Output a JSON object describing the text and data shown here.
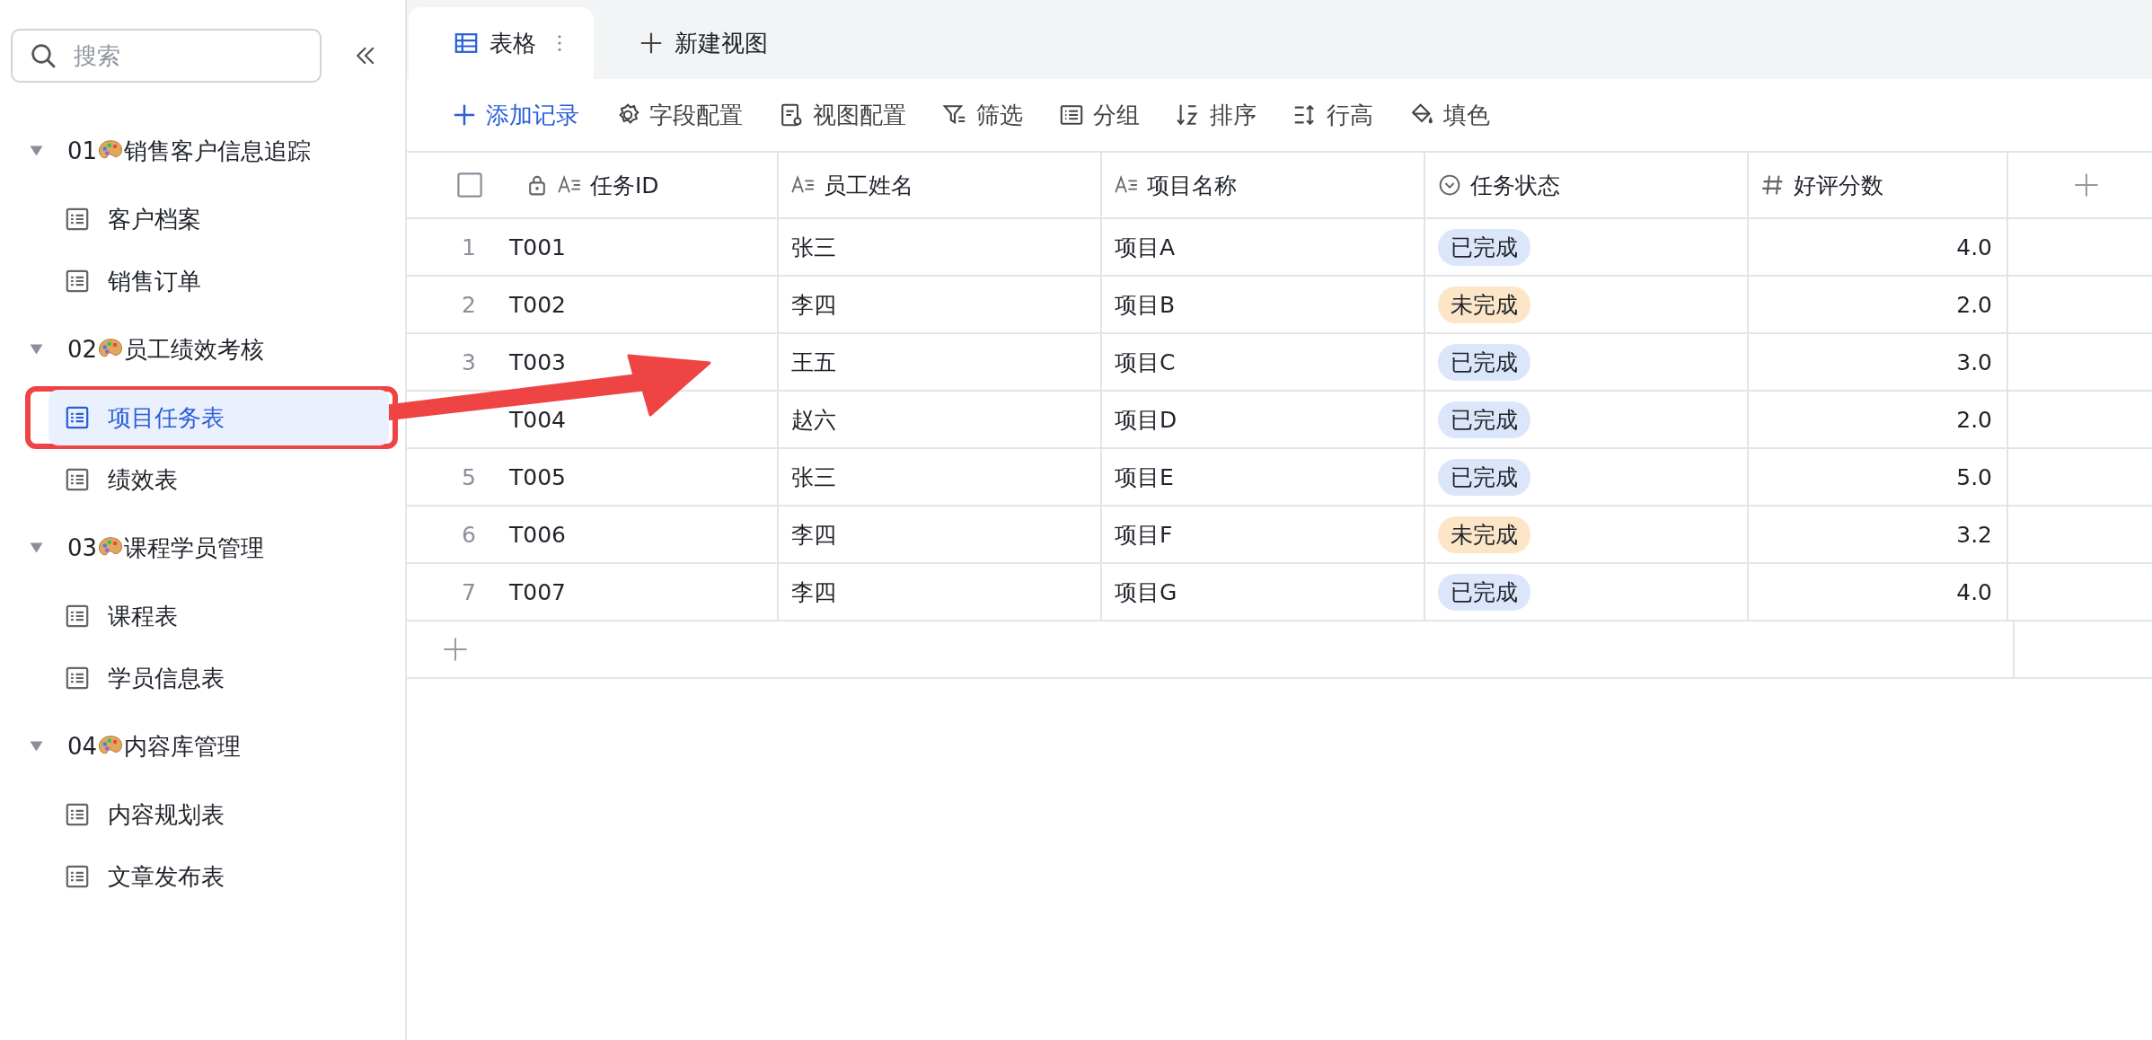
{
  "sidebar": {
    "search": {
      "placeholder": "搜索"
    },
    "groups": [
      {
        "prefix": "01",
        "title": "销售客户信息追踪",
        "expanded": true,
        "children": [
          {
            "label": "客户档案",
            "selected": false
          },
          {
            "label": "销售订单",
            "selected": false
          }
        ]
      },
      {
        "prefix": "02",
        "title": "员工绩效考核",
        "expanded": true,
        "children": [
          {
            "label": "项目任务表",
            "selected": true
          },
          {
            "label": "绩效表",
            "selected": false
          }
        ]
      },
      {
        "prefix": "03",
        "title": "课程学员管理",
        "expanded": true,
        "children": [
          {
            "label": "课程表",
            "selected": false
          },
          {
            "label": "学员信息表",
            "selected": false
          }
        ]
      },
      {
        "prefix": "04",
        "title": "内容库管理",
        "expanded": true,
        "children": [
          {
            "label": "内容规划表",
            "selected": false
          },
          {
            "label": "文章发布表",
            "selected": false
          }
        ]
      }
    ]
  },
  "view_tabs": [
    {
      "label": "表格",
      "selected": true
    },
    {
      "label": "新建视图",
      "selected": false
    }
  ],
  "toolbar": [
    {
      "label": "添加记录",
      "kind": "primary"
    },
    {
      "label": "字段配置",
      "kind": "tool"
    },
    {
      "label": "视图配置",
      "kind": "tool"
    },
    {
      "label": "筛选",
      "kind": "tool"
    },
    {
      "label": "分组",
      "kind": "tool"
    },
    {
      "label": "排序",
      "kind": "tool"
    },
    {
      "label": "行高",
      "kind": "tool"
    },
    {
      "label": "填色",
      "kind": "tool"
    }
  ],
  "table": {
    "select_all": {
      "checked": false
    },
    "columns": [
      {
        "label": "任务ID",
        "kind": "text",
        "locked": true
      },
      {
        "label": "员工姓名",
        "kind": "text",
        "locked": false
      },
      {
        "label": "项目名称",
        "kind": "text",
        "locked": false
      },
      {
        "label": "任务状态",
        "kind": "select",
        "locked": false
      },
      {
        "label": "好评分数",
        "kind": "number",
        "locked": false
      }
    ],
    "rows": [
      {
        "number": "1",
        "cells": [
          "T001",
          "张三",
          "项目A",
          {
            "text": "已完成",
            "color": "#dce6fb"
          },
          "4.0"
        ]
      },
      {
        "number": "2",
        "cells": [
          "T002",
          "李四",
          "项目B",
          {
            "text": "未完成",
            "color": "#fde6c8"
          },
          "2.0"
        ]
      },
      {
        "number": "3",
        "cells": [
          "T003",
          "王五",
          "项目C",
          {
            "text": "已完成",
            "color": "#dce6fb"
          },
          "3.0"
        ]
      },
      {
        "cells": [
          "T004",
          "赵六",
          "项目D",
          {
            "text": "已完成",
            "color": "#dce6fb"
          },
          "2.0"
        ]
      },
      {
        "number": "5",
        "cells": [
          "T005",
          "张三",
          "项目E",
          {
            "text": "已完成",
            "color": "#dce6fb"
          },
          "5.0"
        ]
      },
      {
        "number": "6",
        "cells": [
          "T006",
          "李四",
          "项目F",
          {
            "text": "未完成",
            "color": "#fde6c8"
          },
          "3.2"
        ]
      },
      {
        "number": "7",
        "cells": [
          "T007",
          "李四",
          "项目G",
          {
            "text": "已完成",
            "color": "#dce6fb"
          },
          "4.0"
        ]
      }
    ]
  },
  "annotation": {
    "highlight": true,
    "arrow": true
  }
}
